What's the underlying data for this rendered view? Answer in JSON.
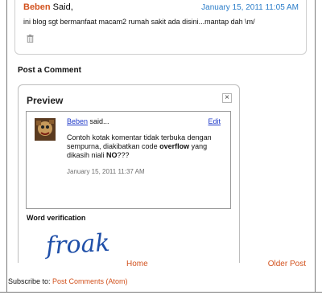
{
  "comment": {
    "author": "Beben",
    "said": " Said,",
    "date": "January 15, 2011 11:05 AM",
    "body": "ini blog sgt bermanfaat macam2 rumah sakit ada disini...mantap dah \\m/"
  },
  "post_comment": {
    "heading": "Post a Comment"
  },
  "preview": {
    "title": "Preview",
    "close": "×",
    "author": "Beben",
    "said": " said...",
    "edit": "Edit",
    "text_1": "Contoh kotak komentar tidak terbuka dengan sempurna, diakibatkan code ",
    "text_bold_1": "overflow",
    "text_2": " yang dikasih niali ",
    "text_bold_2": "NO",
    "text_3": "???",
    "date": "January 15, 2011 11:37 AM"
  },
  "word_verification": {
    "label": "Word verification",
    "captcha": "froak"
  },
  "footer": {
    "home": "Home",
    "older": "Older Post",
    "subscribe_prefix": "Subscribe to: ",
    "subscribe_link": "Post Comments (Atom)"
  },
  "colors": {
    "link_orange": "#d2521e",
    "date_blue": "#2b7dc9",
    "preview_link": "#1f39c9"
  },
  "icons": {
    "delete": "trash-icon",
    "close": "close-icon"
  }
}
